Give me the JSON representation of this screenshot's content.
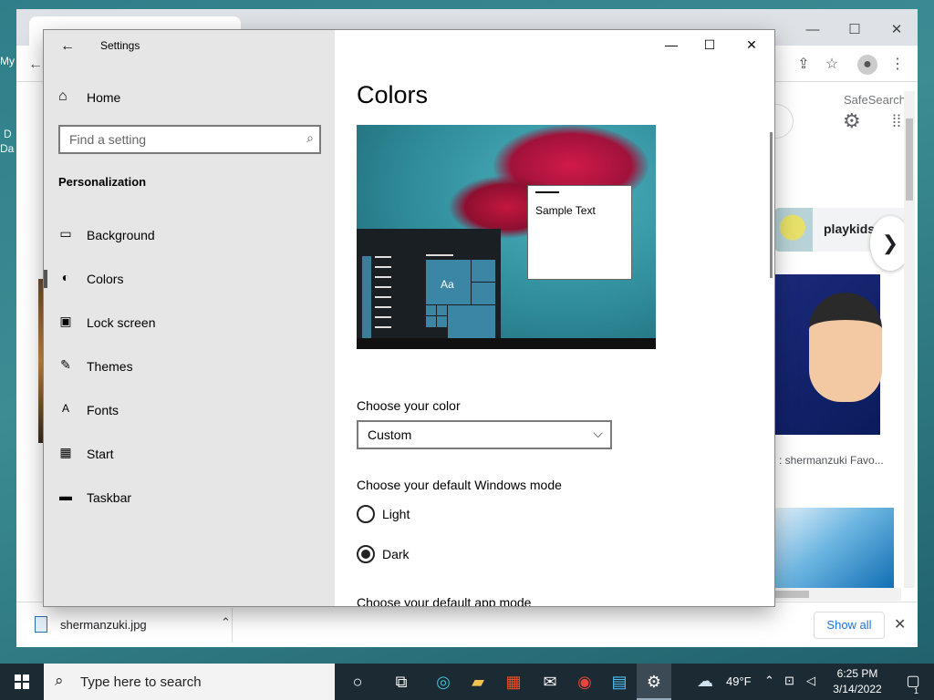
{
  "desktop": {
    "label_1": "My",
    "label_2": "D",
    "label_3": "Da"
  },
  "browser": {
    "safesearch_label": "SafeSearch",
    "chip_label": "playkids",
    "result_caption": ": shermanzuki Favo...",
    "download": {
      "filename": "shermanzuki.jpg",
      "show_all": "Show all"
    }
  },
  "settings": {
    "app_title": "Settings",
    "home_label": "Home",
    "search_placeholder": "Find a setting",
    "section_title": "Personalization",
    "nav": [
      {
        "label": "Background",
        "icon": "image-icon"
      },
      {
        "label": "Colors",
        "icon": "palette-icon"
      },
      {
        "label": "Lock screen",
        "icon": "lock-screen-icon"
      },
      {
        "label": "Themes",
        "icon": "brush-icon"
      },
      {
        "label": "Fonts",
        "icon": "font-icon"
      },
      {
        "label": "Start",
        "icon": "start-tiles-icon"
      },
      {
        "label": "Taskbar",
        "icon": "taskbar-icon"
      }
    ],
    "active_nav": "Colors",
    "page_title": "Colors",
    "preview": {
      "sample_text": "Sample Text",
      "tile_text": "Aa"
    },
    "choose_color_label": "Choose your color",
    "color_value": "Custom",
    "windows_mode_label": "Choose your default Windows mode",
    "mode_options": [
      {
        "label": "Light",
        "checked": false
      },
      {
        "label": "Dark",
        "checked": true
      }
    ],
    "app_mode_label": "Choose your default app mode"
  },
  "taskbar": {
    "search_placeholder": "Type here to search",
    "weather": "49°F",
    "time": "6:25 PM",
    "date": "3/14/2022",
    "notification_count": "1"
  },
  "colors": {
    "taskbar_bg": "#1c2a33",
    "sidebar_bg": "#e6e6e6",
    "accent_tile": "#3a86a4"
  }
}
